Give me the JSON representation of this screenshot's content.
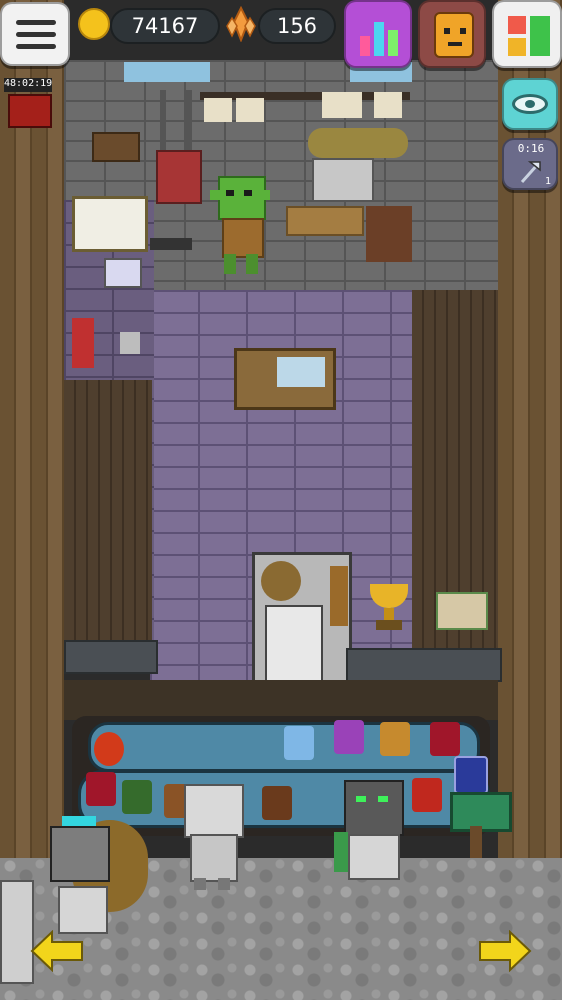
{
  "hud": {
    "coins": "74167",
    "crystals": "156",
    "event_timer": "48:02:19",
    "crafting_timer": "0:16",
    "crafting_count": "1"
  },
  "icons": {
    "menu": "hamburger-menu-icon",
    "coin": "gold-coin-icon",
    "crystal": "orange-crystal-icon",
    "stats": "bar-chart-icon",
    "character": "character-portrait-icon",
    "layout": "shop-layout-icon",
    "visibility": "eye-icon",
    "craft": "axe-icon",
    "left": "left-arrow-icon",
    "right": "right-arrow-icon"
  },
  "colors": {
    "coin_pill": "#2e3438",
    "stats_button": "#b44fd6",
    "character_button": "#8d4a46",
    "layout_button": "#f0f0f0",
    "eye_button": "#5ed3d3",
    "craft_button": "#6b6b8a",
    "arrow": "#f2d51b"
  }
}
